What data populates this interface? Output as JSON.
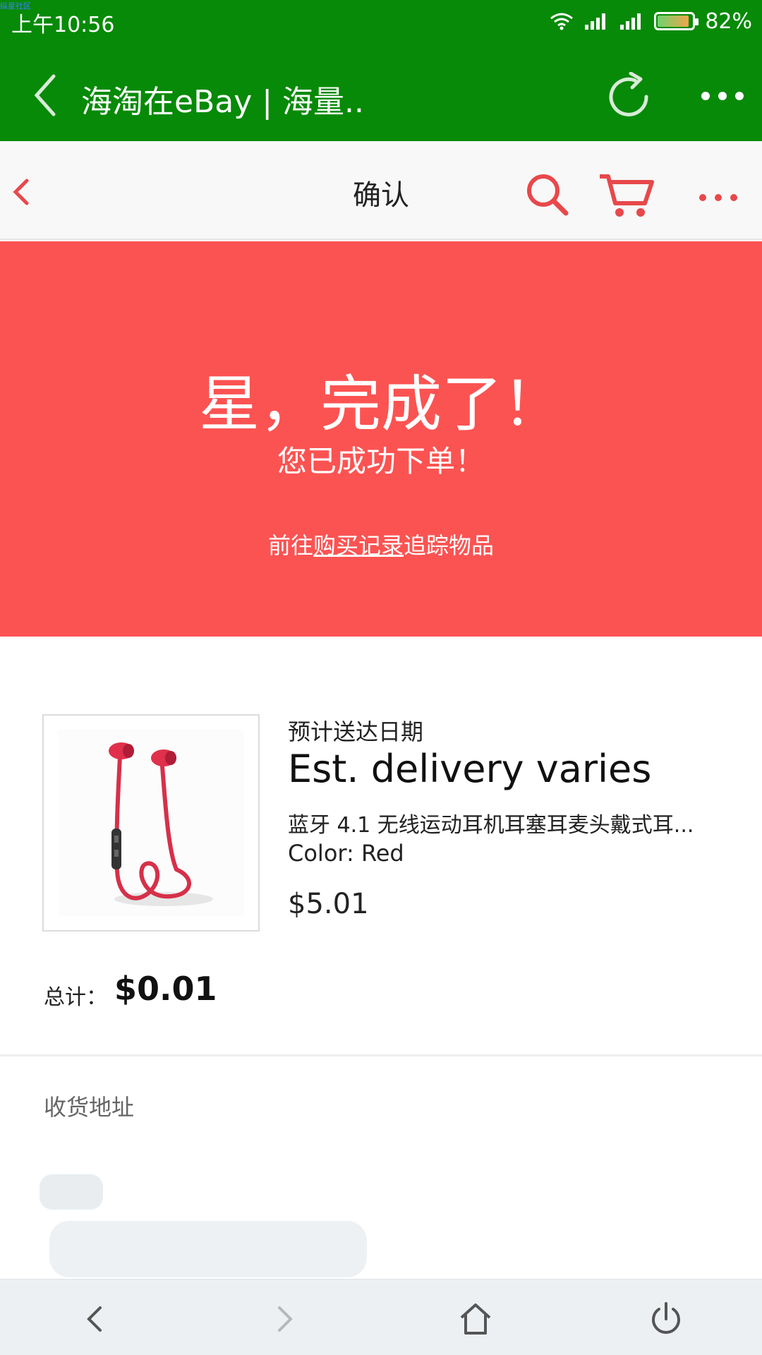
{
  "status_bar": {
    "watermark": "纵星社区",
    "time": "上午10:56",
    "battery": "82%"
  },
  "browser": {
    "title": "海淘在eBay | 海量..",
    "icons": [
      "back-icon",
      "refresh-icon",
      "more-icon"
    ]
  },
  "navbar": {
    "title": "确认",
    "icons": [
      "chevron-left-icon",
      "search-icon",
      "cart-icon",
      "more-icon"
    ]
  },
  "banner": {
    "heading": "星，完成了！",
    "subheading": "您已成功下单！",
    "link_prefix": "前往",
    "link_text": "购买记录",
    "link_suffix": "追踪物品"
  },
  "item": {
    "eta_label": "预计送达日期",
    "eta_value": "Est. delivery varies",
    "title": "蓝牙 4.1 无线运动耳机耳塞耳麦头戴式耳...",
    "color": "Color: Red",
    "price": "$5.01"
  },
  "total": {
    "label": "总计：",
    "value": "$0.01"
  },
  "address": {
    "label": "收货地址"
  },
  "colors": {
    "status_green": "#078a07",
    "banner_red": "#fb5352",
    "accent_red": "#e8484b"
  }
}
